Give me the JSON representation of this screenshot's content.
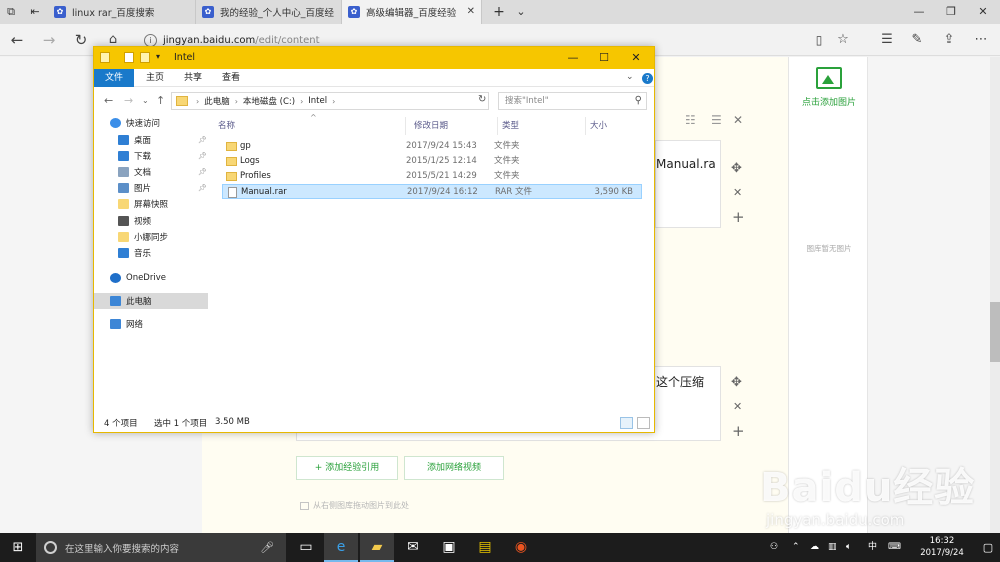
{
  "browser": {
    "tabs": [
      {
        "title": "linux rar_百度搜索"
      },
      {
        "title": "我的经验_个人中心_百度经"
      },
      {
        "title": "高级编辑器_百度经验"
      }
    ],
    "url_host": "jingyan.baidu.com",
    "url_path": "/edit/content",
    "new_tab": "+",
    "tab_close": "✕"
  },
  "editor": {
    "text_1": "Manual.ra",
    "text_2": "这个压缩",
    "add_citation": "+ 添加经验引用",
    "add_video": "添加网络视频",
    "drag_hint": "从右侧图库拖动图片到此处"
  },
  "sidepanel": {
    "add_picture": "点击添加图片",
    "no_picture": "图库暂无图片"
  },
  "watermark": {
    "logo": "Baidu经验",
    "url": "jingyan.baidu.com"
  },
  "explorer": {
    "title": "Intel",
    "ribbon_tabs": [
      "文件",
      "主页",
      "共享",
      "查看"
    ],
    "path": [
      "此电脑",
      "本地磁盘 (C:)",
      "Intel"
    ],
    "search_placeholder": "搜索\"Intel\"",
    "nav": [
      {
        "label": "快速访问",
        "icon": "star-icon"
      },
      {
        "label": "桌面",
        "icon": "desktop-icon",
        "pinned": true
      },
      {
        "label": "下载",
        "icon": "download-icon",
        "pinned": true
      },
      {
        "label": "文档",
        "icon": "documents-icon",
        "pinned": true
      },
      {
        "label": "图片",
        "icon": "pictures-icon",
        "pinned": true
      },
      {
        "label": "屏幕快照",
        "icon": "folder-icon"
      },
      {
        "label": "视频",
        "icon": "videos-icon"
      },
      {
        "label": "小娜同步",
        "icon": "folder-icon"
      },
      {
        "label": "音乐",
        "icon": "music-icon"
      },
      {
        "label": "OneDrive",
        "icon": "onedrive-icon"
      },
      {
        "label": "此电脑",
        "icon": "this-pc-icon",
        "selected": true
      },
      {
        "label": "网络",
        "icon": "network-icon"
      }
    ],
    "columns": {
      "name": "名称",
      "date": "修改日期",
      "type": "类型",
      "size": "大小"
    },
    "files": [
      {
        "name": "gp",
        "date": "2017/9/24 15:43",
        "type": "文件夹",
        "size": "",
        "kind": "folder"
      },
      {
        "name": "Logs",
        "date": "2015/1/25 12:14",
        "type": "文件夹",
        "size": "",
        "kind": "folder"
      },
      {
        "name": "Profiles",
        "date": "2015/5/21 14:29",
        "type": "文件夹",
        "size": "",
        "kind": "folder"
      },
      {
        "name": "Manual.rar",
        "date": "2017/9/24 16:12",
        "type": "RAR 文件",
        "size": "3,590 KB",
        "kind": "file",
        "selected": true
      }
    ],
    "status": {
      "count": "4 个项目",
      "selected": "选中 1 个项目",
      "size": "3.50 MB"
    }
  },
  "taskbar": {
    "search_placeholder": "在这里输入你要搜索的内容",
    "tray_lang": "中",
    "time": "16:32",
    "date": "2017/9/24"
  },
  "colors": {
    "explorer_title": "#f6c600",
    "ribbon_file": "#1979ca",
    "selected_row": "#cce8ff",
    "editor_green": "#2aa13b",
    "taskbar": "#1c1c1c"
  }
}
